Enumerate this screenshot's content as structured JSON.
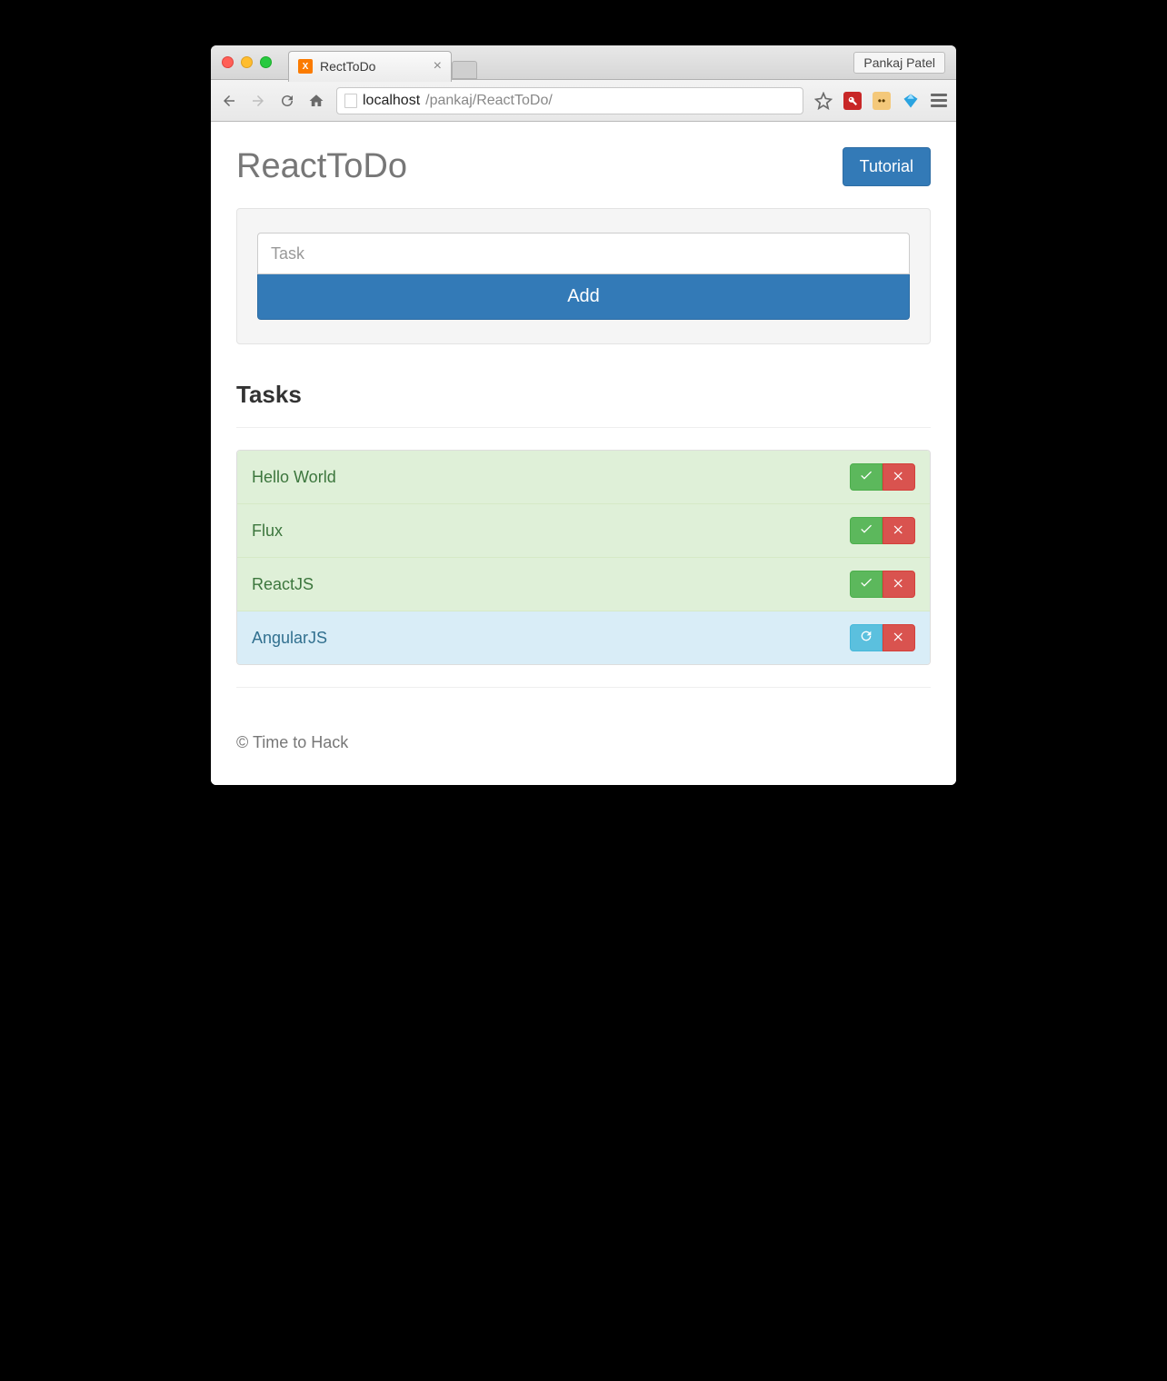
{
  "browser": {
    "tab_title": "RectToDo",
    "user_name": "Pankaj Patel",
    "url_host": "localhost",
    "url_path": "/pankaj/ReactToDo/"
  },
  "header": {
    "title": "ReactToDo",
    "tutorial_button": "Tutorial"
  },
  "form": {
    "placeholder": "Task",
    "add_button": "Add"
  },
  "tasks_section_title": "Tasks",
  "tasks": [
    {
      "name": "Hello World",
      "status": "success",
      "action_icon": "check"
    },
    {
      "name": "Flux",
      "status": "success",
      "action_icon": "check"
    },
    {
      "name": "ReactJS",
      "status": "success",
      "action_icon": "check"
    },
    {
      "name": "AngularJS",
      "status": "info",
      "action_icon": "refresh"
    }
  ],
  "footer": {
    "text": "© Time to Hack"
  }
}
